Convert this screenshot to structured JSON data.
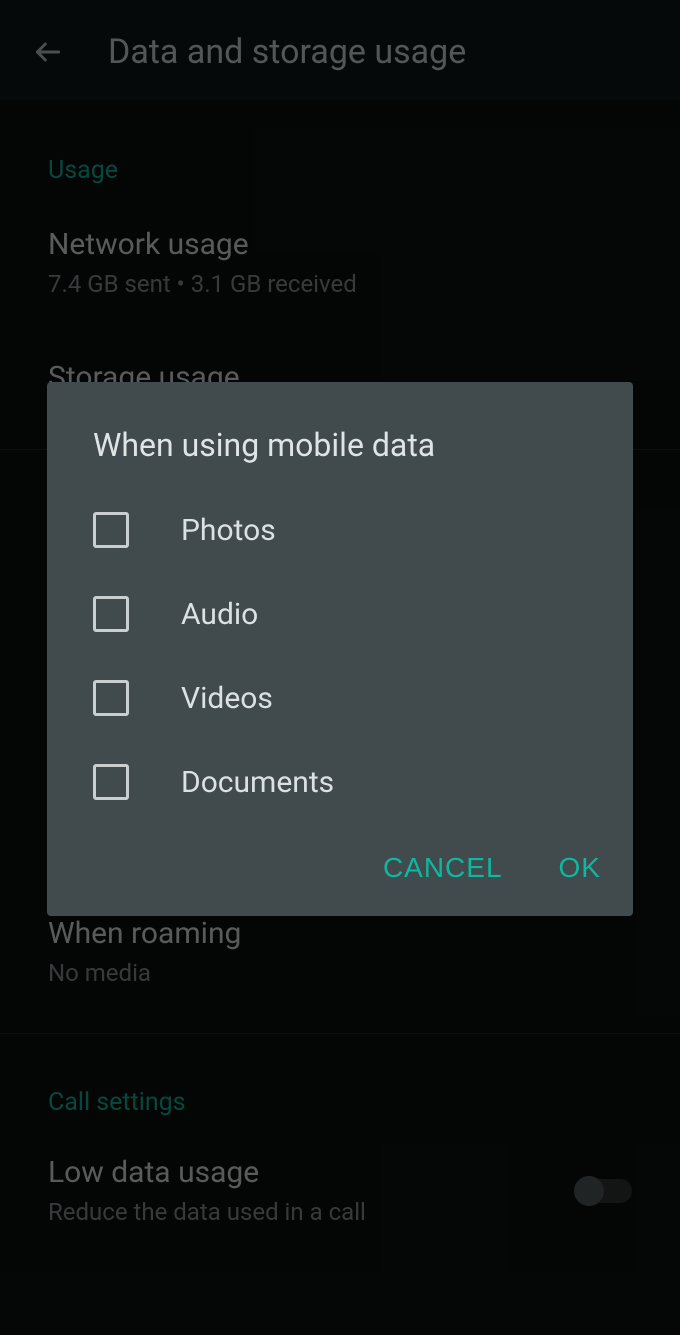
{
  "header": {
    "title": "Data and storage usage"
  },
  "sections": {
    "usage": {
      "header": "Usage",
      "network_title": "Network usage",
      "network_subtitle": "7.4 GB sent • 3.1 GB received",
      "storage_title": "Storage usage"
    },
    "roaming": {
      "title": "When roaming",
      "subtitle": "No media"
    },
    "call_settings": {
      "header": "Call settings",
      "low_data_title": "Low data usage",
      "low_data_subtitle": "Reduce the data used in a call"
    }
  },
  "dialog": {
    "title": "When using mobile data",
    "options": {
      "photos": "Photos",
      "audio": "Audio",
      "videos": "Videos",
      "documents": "Documents"
    },
    "cancel": "CANCEL",
    "ok": "OK"
  }
}
